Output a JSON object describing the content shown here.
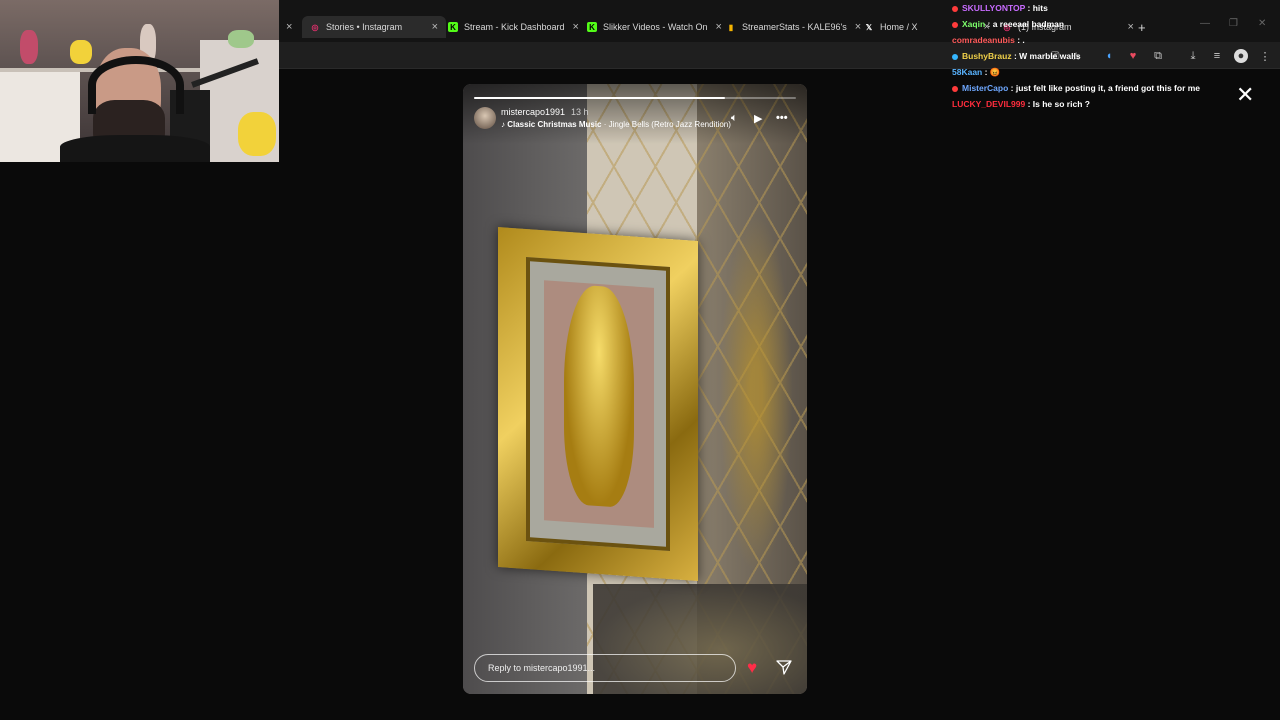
{
  "browser": {
    "tabs": [
      {
        "label": "Stories • Instagram",
        "fav_color": "#e1306c",
        "fav_glyph": "◎"
      },
      {
        "label": "Stream - Kick Dashboard",
        "fav_color": "#53fc18",
        "fav_glyph": "K"
      },
      {
        "label": "Slikker Videos - Watch On",
        "fav_color": "#53fc18",
        "fav_glyph": "K"
      },
      {
        "label": "StreamerStats - KALE96's",
        "fav_color": "#f5b400",
        "fav_glyph": "▮"
      },
      {
        "label": "Home / X",
        "fav_color": "#ffffff",
        "fav_glyph": "X"
      },
      {
        "label": "(1) Instagram",
        "fav_color": "#e1306c",
        "fav_glyph": "◎"
      }
    ],
    "new_tab_glyph": "+"
  },
  "chat": [
    {
      "user": "SKULLYONTOP",
      "user_color": "#c86bff",
      "text": "hits"
    },
    {
      "user": "Xaqin",
      "user_color": "#7dff6b",
      "text": "a reeeaal badman"
    },
    {
      "user": "comradeanubis",
      "user_color": "#ff5a5a",
      "text": "."
    },
    {
      "user": "BushyBrauz",
      "user_color": "#f1d14a",
      "text": "W marble walls"
    },
    {
      "user": "58Kaan",
      "user_color": "#5ab4ff",
      "text": "😡"
    },
    {
      "user": "MisterCapo",
      "user_color": "#6fa8ff",
      "text": "just felt like posting it, a friend got this for me"
    },
    {
      "user": "LUCKY_DEVIL999",
      "user_color": "#ff2d3d",
      "text": "Is he so rich ?"
    }
  ],
  "story": {
    "username": "mistercapo1991",
    "time": "13 h",
    "music_artist": "Classic Christmas Music",
    "music_sep": " · ",
    "music_track": "Jingle Bells (Retro Jazz Rendition)",
    "progress": 0.78,
    "reply_placeholder": "Reply to mistercapo1991..."
  },
  "icons": {
    "close": "close-icon",
    "mute": "speaker-icon",
    "play": "play-icon",
    "more": "more-icon",
    "like": "heart-icon",
    "send": "send-icon"
  }
}
